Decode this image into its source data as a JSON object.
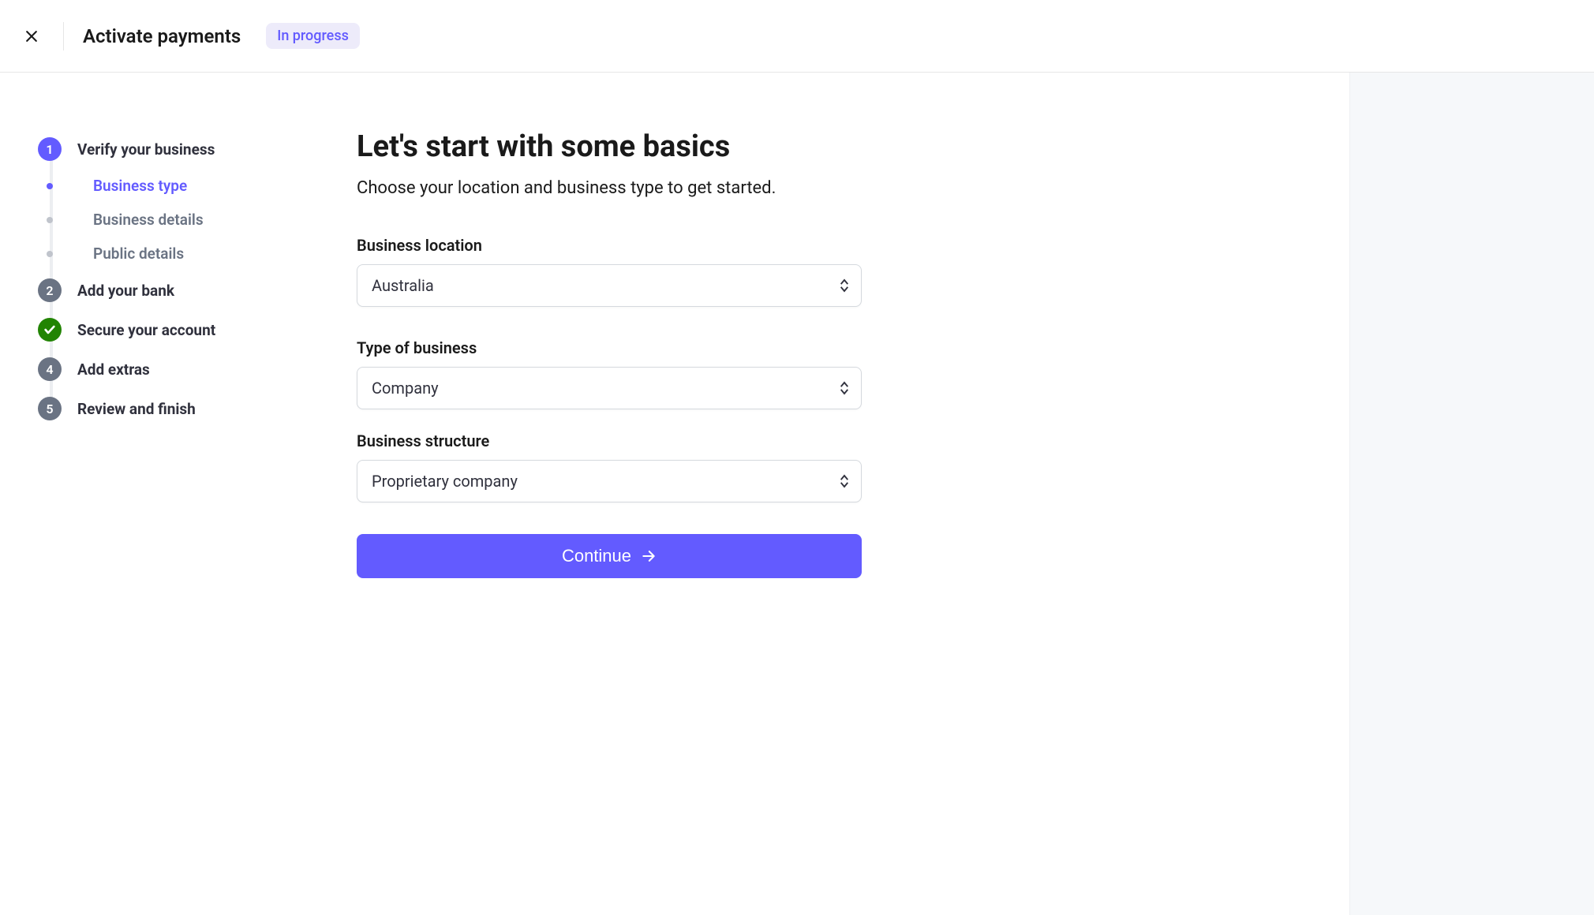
{
  "header": {
    "title": "Activate payments",
    "status_badge": "In progress"
  },
  "stepper": {
    "steps": [
      {
        "number": "1",
        "label": "Verify your business",
        "state": "active",
        "substeps": [
          {
            "label": "Business type",
            "active": true
          },
          {
            "label": "Business details",
            "active": false
          },
          {
            "label": "Public details",
            "active": false
          }
        ]
      },
      {
        "number": "2",
        "label": "Add your bank",
        "state": "pending"
      },
      {
        "number": "",
        "label": "Secure your account",
        "state": "done"
      },
      {
        "number": "4",
        "label": "Add extras",
        "state": "pending"
      },
      {
        "number": "5",
        "label": "Review and finish",
        "state": "pending"
      }
    ]
  },
  "form": {
    "heading": "Let's start with some basics",
    "subheading": "Choose your location and business type to get started.",
    "fields": {
      "business_location": {
        "label": "Business location",
        "value": "Australia"
      },
      "type_of_business": {
        "label": "Type of business",
        "value": "Company"
      },
      "business_structure": {
        "label": "Business structure",
        "value": "Proprietary company"
      }
    },
    "continue_label": "Continue"
  },
  "colors": {
    "accent": "#635bff",
    "success": "#228403"
  }
}
